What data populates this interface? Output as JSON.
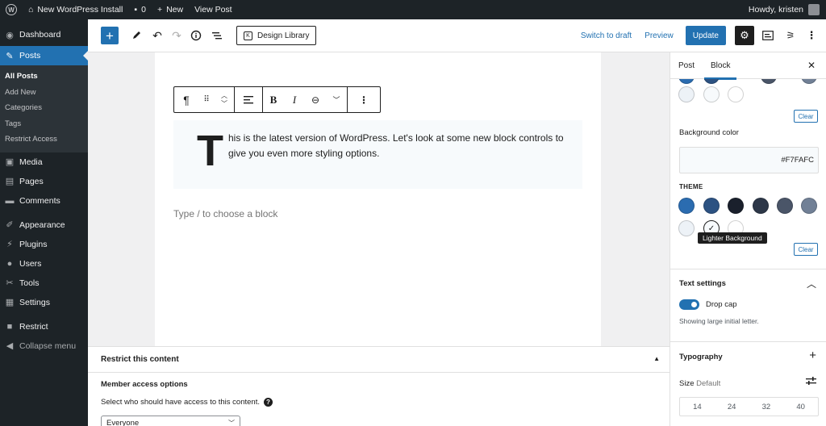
{
  "admin_bar": {
    "site_name": "New WordPress Install",
    "comments_count": "0",
    "new_label": "New",
    "view_post_label": "View Post",
    "greeting": "Howdy, kristen"
  },
  "admin_menu": {
    "dashboard": "Dashboard",
    "posts": "Posts",
    "posts_sub": [
      "All Posts",
      "Add New",
      "Categories",
      "Tags",
      "Restrict Access"
    ],
    "media": "Media",
    "pages": "Pages",
    "comments": "Comments",
    "appearance": "Appearance",
    "plugins": "Plugins",
    "users": "Users",
    "tools": "Tools",
    "settings": "Settings",
    "restrict": "Restrict",
    "collapse": "Collapse menu"
  },
  "editor_header": {
    "design_library_label": "Design Library",
    "switch_to_draft_label": "Switch to draft",
    "preview_label": "Preview",
    "update_label": "Update"
  },
  "canvas": {
    "drop_cap_letter": "T",
    "paragraph_text": "his is the latest version of WordPress. Let's look at some new block controls to give you even more styling options.",
    "placeholder": "Type / to choose a block"
  },
  "meta_box": {
    "title": "Restrict this content",
    "access_label": "Member access options",
    "access_desc": "Select who should have access to this content.",
    "access_selected": "Everyone"
  },
  "sidebar": {
    "tab_post": "Post",
    "tab_block": "Block",
    "clear_label": "Clear",
    "background_color_label": "Background color",
    "background_color_value": "#F7FAFC",
    "theme_label": "THEME",
    "theme_colors": [
      "#2b6cb0",
      "#2c5282",
      "#1a202c",
      "#2d3748",
      "#4a5568",
      "#718096",
      "#edf2f7",
      "#f7fafc",
      "#ffffff"
    ],
    "top_swatches": [
      "#edf2f7",
      "#f7fafc",
      "#ffffff"
    ],
    "selected_color_name": "Lighter Background",
    "text_settings_title": "Text settings",
    "drop_cap_label": "Drop cap",
    "drop_cap_help": "Showing large initial letter.",
    "typography_title": "Typography",
    "size_label": "Size",
    "size_value": "Default",
    "font_sizes": [
      "14",
      "24",
      "32",
      "40"
    ]
  }
}
